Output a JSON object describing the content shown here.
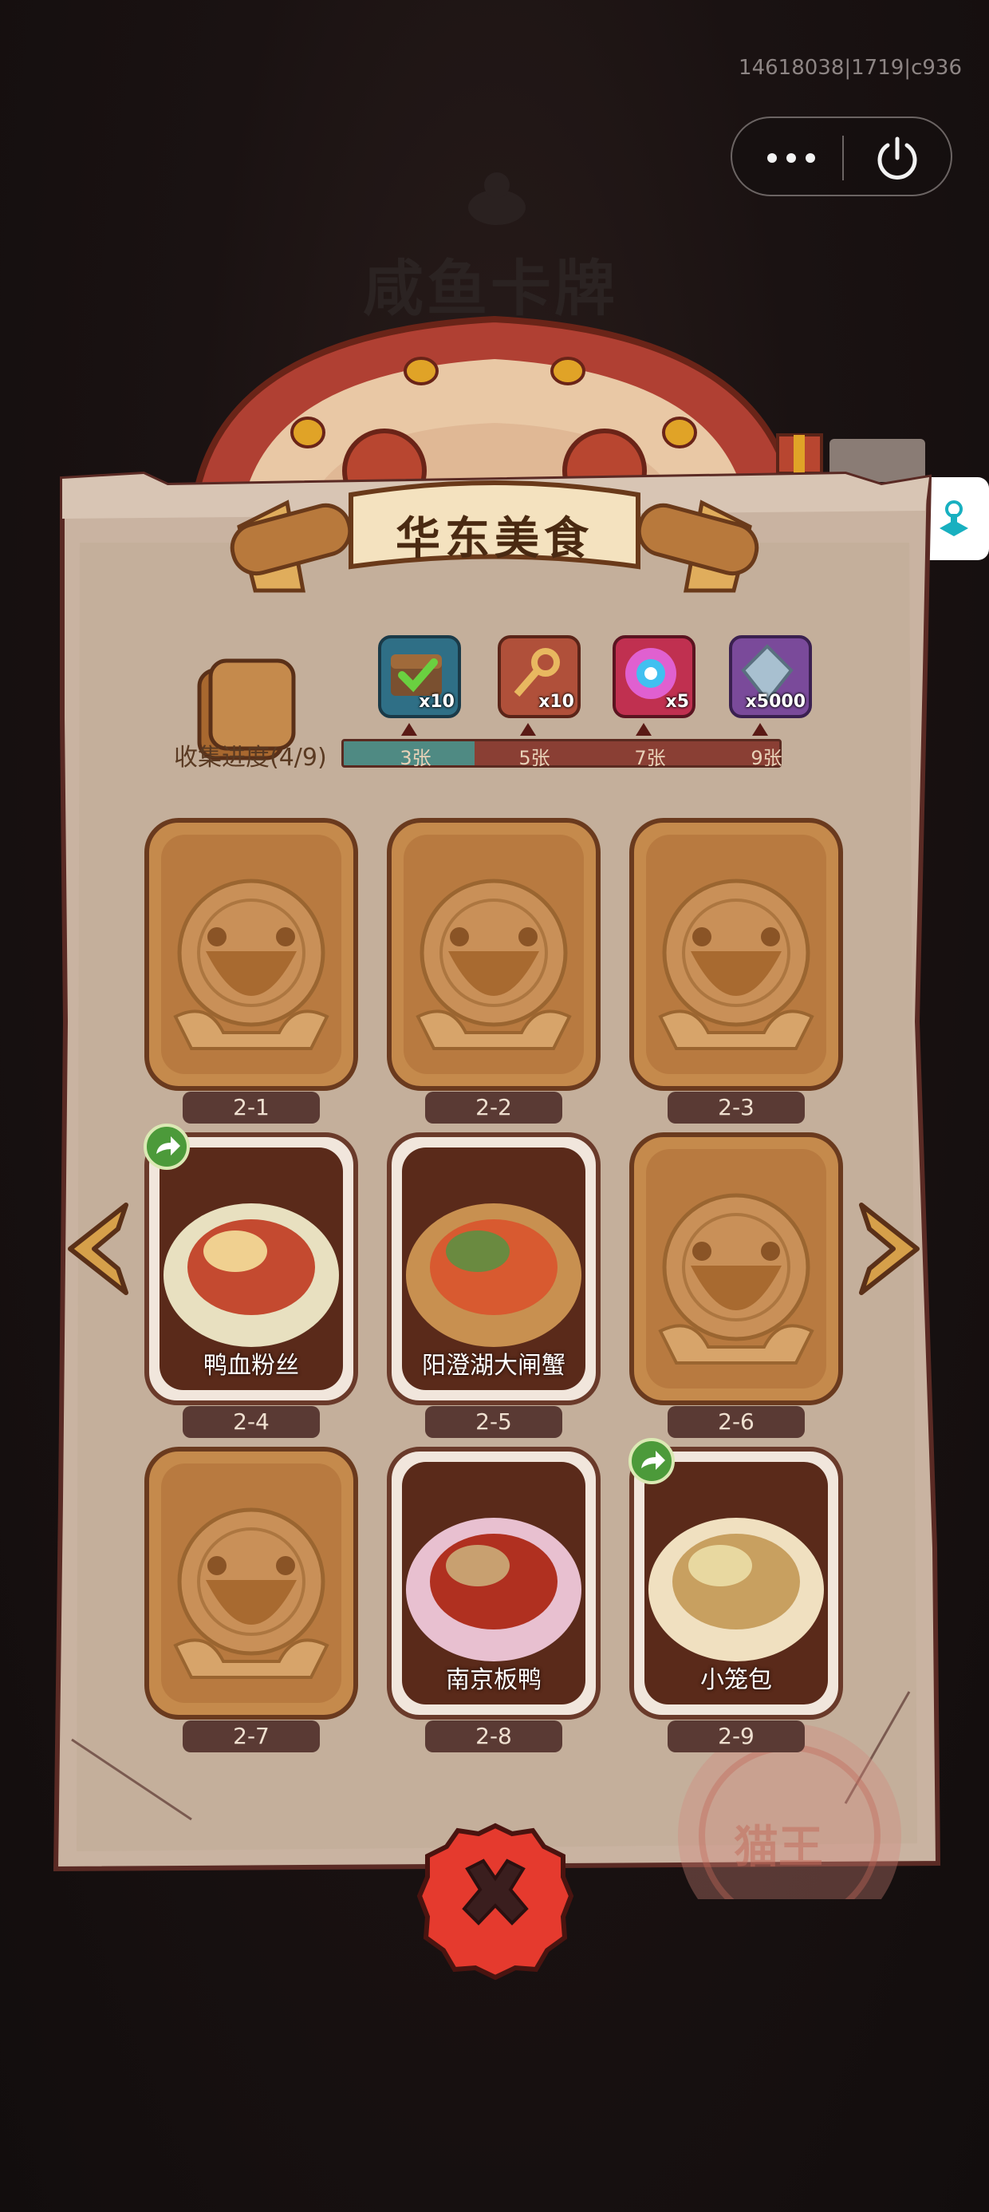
{
  "header": {
    "id_text": "14618038|1719|c936",
    "faded_title": "咸鱼卡牌"
  },
  "capsule": {
    "more_label": "more",
    "power_label": "power"
  },
  "panel": {
    "title": "华东美食",
    "progress_label": "收集进度(4/9)",
    "progress": {
      "collected": 4,
      "total": 9,
      "bar_fraction": 0.3
    },
    "rewards": [
      {
        "name": "chest-icon",
        "qty": "x10",
        "threshold": "3张",
        "color": "#2f6f86"
      },
      {
        "name": "key-icon",
        "qty": "x10",
        "threshold": "5张",
        "color": "#b0503a"
      },
      {
        "name": "orb-icon",
        "qty": "x5",
        "threshold": "7张",
        "color": "#c03050"
      },
      {
        "name": "crystal-icon",
        "qty": "x5000",
        "threshold": "9张",
        "color": "#7a4a9a"
      }
    ],
    "cards": [
      {
        "id": "2-1",
        "name": "",
        "collected": false
      },
      {
        "id": "2-2",
        "name": "",
        "collected": false
      },
      {
        "id": "2-3",
        "name": "",
        "collected": false
      },
      {
        "id": "2-4",
        "name": "鸭血粉丝",
        "collected": true,
        "shareable": true
      },
      {
        "id": "2-5",
        "name": "阳澄湖大闸蟹",
        "collected": true,
        "shareable": false
      },
      {
        "id": "2-6",
        "name": "",
        "collected": false
      },
      {
        "id": "2-7",
        "name": "",
        "collected": false
      },
      {
        "id": "2-8",
        "name": "南京板鸭",
        "collected": true,
        "shareable": false
      },
      {
        "id": "2-9",
        "name": "小笼包",
        "collected": true,
        "shareable": true
      }
    ],
    "stamp_text": "猫王"
  },
  "colors": {
    "parchment": "#c7b09f",
    "card_back": "#c58a4c",
    "close_red": "#e53a2e",
    "progress_fill": "#4f8a83"
  }
}
